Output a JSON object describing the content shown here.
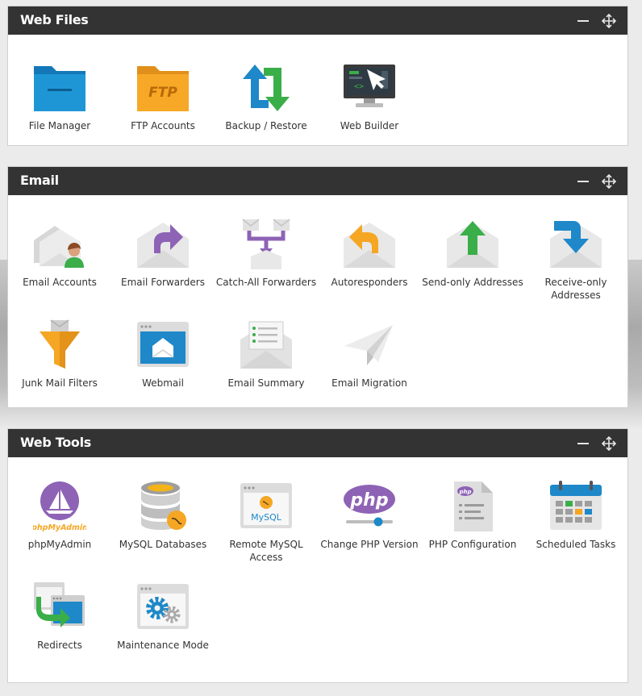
{
  "panels": {
    "web_files": {
      "title": "Web Files",
      "items": [
        "File Manager",
        "FTP Accounts",
        "Backup / Restore",
        "Web Builder"
      ]
    },
    "email": {
      "title": "Email",
      "items": [
        "Email Accounts",
        "Email Forwarders",
        "Catch-All Forwarders",
        "Autoresponders",
        "Send-only Addresses",
        "Receive-only Addresses",
        "Junk Mail Filters",
        "Webmail",
        "Email Summary",
        "Email Migration"
      ]
    },
    "web_tools": {
      "title": "Web Tools",
      "items": [
        "phpMyAdmin",
        "MySQL Databases",
        "Remote MySQL Access",
        "Change PHP Version",
        "PHP Configuration",
        "Scheduled Tasks",
        "Redirects",
        "Maintenance Mode"
      ]
    }
  },
  "icon_text": {
    "ftp": "FTP",
    "php": "php",
    "phpmyadmin": "phpMyAdmin",
    "mysql": "MySQL"
  },
  "colors": {
    "header_bg": "#333333",
    "accent_blue": "#1e88c9",
    "accent_orange": "#f5a623",
    "accent_green": "#3aae49",
    "accent_purple": "#8e63b5"
  }
}
